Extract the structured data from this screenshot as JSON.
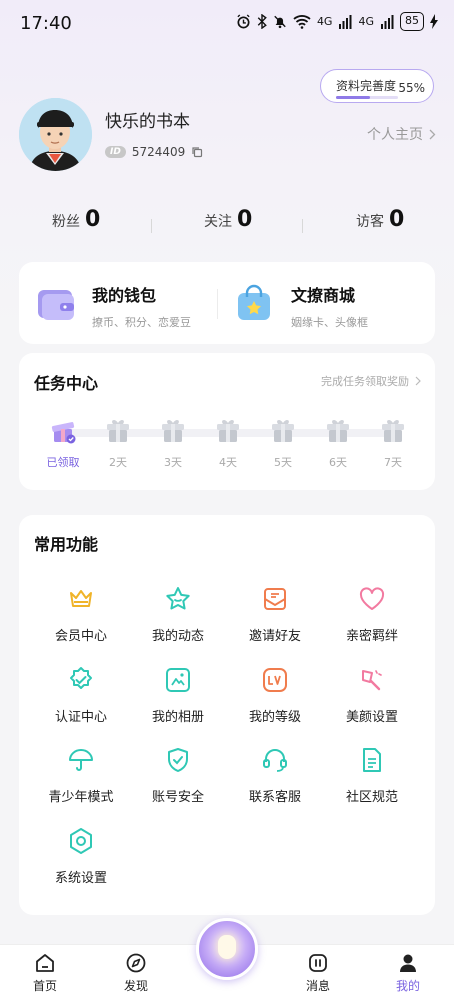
{
  "status_bar": {
    "time": "17:40",
    "network1": "4G",
    "network2": "4G",
    "battery": "85"
  },
  "profile": {
    "completeness_label": "资料完善度",
    "completeness_pct": "55%",
    "completeness_value": 0.55,
    "username": "快乐的书本",
    "id_badge": "ID",
    "id_value": "5724409",
    "home_link": "个人主页"
  },
  "stats": [
    {
      "label": "粉丝",
      "value": "0"
    },
    {
      "label": "关注",
      "value": "0"
    },
    {
      "label": "访客",
      "value": "0"
    }
  ],
  "wallet": {
    "title": "我的钱包",
    "subtitle": "撩币、积分、恋爱豆",
    "mall_title": "文撩商城",
    "mall_subtitle": "姻缘卡、头像框"
  },
  "tasks": {
    "title": "任务中心",
    "link": "完成任务领取奖励",
    "days": [
      "已领取",
      "2天",
      "3天",
      "4天",
      "5天",
      "6天",
      "7天"
    ],
    "claimed_count": 1
  },
  "functions": {
    "title": "常用功能",
    "items": [
      {
        "label": "会员中心",
        "icon": "crown-icon"
      },
      {
        "label": "我的动态",
        "icon": "star-icon"
      },
      {
        "label": "邀请好友",
        "icon": "envelope-icon"
      },
      {
        "label": "亲密羁绊",
        "icon": "heart-icon"
      },
      {
        "label": "认证中心",
        "icon": "verified-badge-icon"
      },
      {
        "label": "我的相册",
        "icon": "album-icon"
      },
      {
        "label": "我的等级",
        "icon": "level-icon"
      },
      {
        "label": "美颜设置",
        "icon": "beauty-brush-icon"
      },
      {
        "label": "青少年模式",
        "icon": "umbrella-icon"
      },
      {
        "label": "账号安全",
        "icon": "shield-icon"
      },
      {
        "label": "联系客服",
        "icon": "headset-icon"
      },
      {
        "label": "社区规范",
        "icon": "document-icon"
      },
      {
        "label": "系统设置",
        "icon": "gear-icon"
      }
    ]
  },
  "tabs": [
    {
      "label": "首页",
      "icon": "home-icon"
    },
    {
      "label": "发现",
      "icon": "compass-icon"
    },
    {
      "label": "消息",
      "icon": "message-icon"
    },
    {
      "label": "我的",
      "icon": "user-icon",
      "active": true
    }
  ],
  "colors": {
    "accent": "#7a63e0",
    "crown": "#f0b429",
    "teal": "#2fc8b5",
    "orange": "#f07c4d",
    "pink": "#f27aa0"
  }
}
